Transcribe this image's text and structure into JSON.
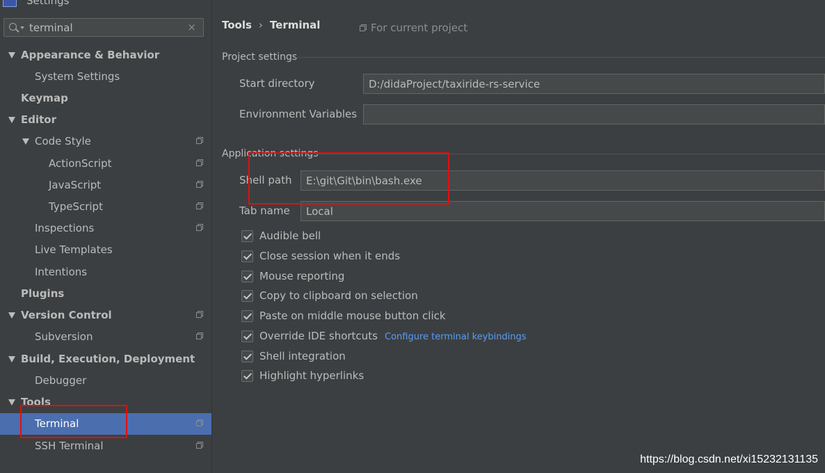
{
  "window": {
    "title": "Settings"
  },
  "search": {
    "value": "terminal",
    "clear_glyph": "×"
  },
  "tree": [
    {
      "label": "Appearance & Behavior",
      "bold": true,
      "level": 0,
      "expanded": true
    },
    {
      "label": "System Settings",
      "bold": false,
      "level": 1
    },
    {
      "label": "Keymap",
      "bold": true,
      "level": 0
    },
    {
      "label": "Editor",
      "bold": true,
      "level": 0,
      "expanded": true
    },
    {
      "label": "Code Style",
      "bold": false,
      "level": 1,
      "expanded": true,
      "project": true
    },
    {
      "label": "ActionScript",
      "bold": false,
      "level": 2,
      "project": true
    },
    {
      "label": "JavaScript",
      "bold": false,
      "level": 2,
      "project": true
    },
    {
      "label": "TypeScript",
      "bold": false,
      "level": 2,
      "project": true
    },
    {
      "label": "Inspections",
      "bold": false,
      "level": 1,
      "project": true
    },
    {
      "label": "Live Templates",
      "bold": false,
      "level": 1
    },
    {
      "label": "Intentions",
      "bold": false,
      "level": 1
    },
    {
      "label": "Plugins",
      "bold": true,
      "level": 0
    },
    {
      "label": "Version Control",
      "bold": true,
      "level": 0,
      "expanded": true,
      "project": true
    },
    {
      "label": "Subversion",
      "bold": false,
      "level": 1,
      "project": true
    },
    {
      "label": "Build, Execution, Deployment",
      "bold": true,
      "level": 0,
      "expanded": true
    },
    {
      "label": "Debugger",
      "bold": false,
      "level": 1
    },
    {
      "label": "Tools",
      "bold": true,
      "level": 0,
      "expanded": true
    },
    {
      "label": "Terminal",
      "bold": false,
      "level": 1,
      "selected": true,
      "project": true
    },
    {
      "label": "SSH Terminal",
      "bold": false,
      "level": 1,
      "project": true
    }
  ],
  "breadcrumb": {
    "parent": "Tools",
    "separator": "›",
    "current": "Terminal"
  },
  "for_project": "For current project",
  "project_settings": {
    "title": "Project settings",
    "start_directory_label": "Start directory",
    "start_directory_value": "D:/didaProject/taxiride-rs-service",
    "env_vars_label": "Environment Variables",
    "env_vars_value": ""
  },
  "application_settings": {
    "title": "Application settings",
    "shell_path_label": "Shell path",
    "shell_path_value": "E:\\git\\Git\\bin\\bash.exe",
    "tab_name_label": "Tab name",
    "tab_name_value": "Local"
  },
  "checkboxes": [
    {
      "label": "Audible bell",
      "checked": true
    },
    {
      "label": "Close session when it ends",
      "checked": true
    },
    {
      "label": "Mouse reporting",
      "checked": true
    },
    {
      "label": "Copy to clipboard on selection",
      "checked": true
    },
    {
      "label": "Paste on middle mouse button click",
      "checked": true
    },
    {
      "label": "Override IDE shortcuts",
      "checked": true
    },
    {
      "label": "Shell integration",
      "checked": true
    },
    {
      "label": "Highlight hyperlinks",
      "checked": true
    }
  ],
  "configure_link": "Configure terminal keybindings",
  "watermark": "https://blog.csdn.net/xi15232131135",
  "colors": {
    "background": "#3c3f41",
    "selection": "#4b6eaf",
    "text": "#bbbbbb",
    "link": "#589df6",
    "highlight_box": "#e01010"
  }
}
